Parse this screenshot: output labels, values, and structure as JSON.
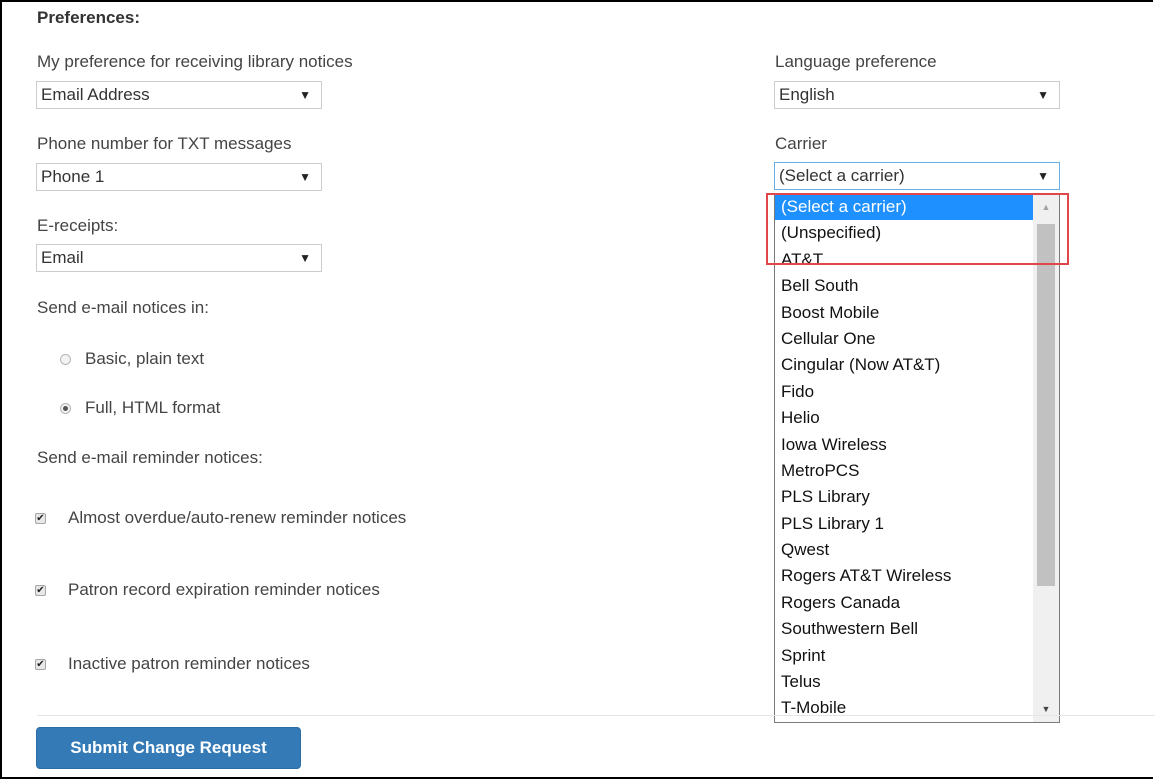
{
  "heading": "Preferences:",
  "left": {
    "notice_pref": {
      "label": "My preference for receiving library notices",
      "value": "Email Address"
    },
    "phone_txt": {
      "label": "Phone number for TXT messages",
      "value": "Phone 1"
    },
    "ereceipts": {
      "label": "E-receipts:",
      "value": "Email"
    },
    "email_format": {
      "label": "Send e-mail notices in:",
      "options": [
        {
          "label": "Basic, plain text",
          "checked": false
        },
        {
          "label": "Full, HTML format",
          "checked": true
        }
      ]
    },
    "reminders": {
      "label": "Send e-mail reminder notices:",
      "items": [
        {
          "label": "Almost overdue/auto-renew reminder notices",
          "checked": true
        },
        {
          "label": "Patron record expiration reminder notices",
          "checked": true
        },
        {
          "label": "Inactive patron reminder notices",
          "checked": true
        }
      ]
    }
  },
  "right": {
    "language": {
      "label": "Language preference",
      "value": "English"
    },
    "carrier": {
      "label": "Carrier",
      "value": "(Select a carrier)",
      "options": [
        "(Select a carrier)",
        "(Unspecified)",
        "AT&T",
        "Bell South",
        "Boost Mobile",
        "Cellular One",
        "Cingular (Now AT&T)",
        "Fido",
        "Helio",
        "Iowa Wireless",
        "MetroPCS",
        "PLS Library",
        "PLS Library 1",
        "Qwest",
        "Rogers AT&T Wireless",
        "Rogers Canada",
        "Southwestern Bell",
        "Sprint",
        "Telus",
        "T-Mobile"
      ]
    }
  },
  "submit_label": "Submit Change Request",
  "colors": {
    "accent": "#337ab7",
    "highlight": "#e0474c",
    "selected_option": "#1e90ff"
  },
  "icons": {
    "select_arrow": "dropdown-arrow-icon",
    "scroll_up": "scroll-up-arrow-icon",
    "scroll_down": "scroll-down-arrow-icon"
  }
}
